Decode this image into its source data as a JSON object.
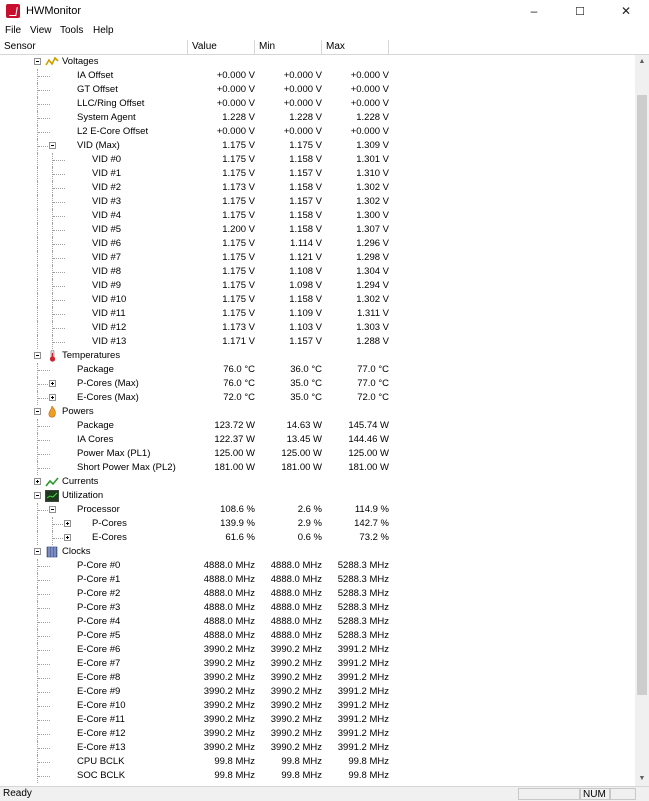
{
  "window": {
    "title": "HWMonitor",
    "minimize": "–",
    "maximize": "☐",
    "close": "✕"
  },
  "menu": [
    "File",
    "View",
    "Tools",
    "Help"
  ],
  "columns": [
    "Sensor",
    "Value",
    "Min",
    "Max"
  ],
  "rows": [
    {
      "depth": 0,
      "type": "category",
      "icon": "voltage-icon",
      "label": "Voltages",
      "exp": "minus"
    },
    {
      "depth": 1,
      "label": "IA Offset",
      "v": "+0.000 V",
      "min": "+0.000 V",
      "max": "+0.000 V"
    },
    {
      "depth": 1,
      "label": "GT Offset",
      "v": "+0.000 V",
      "min": "+0.000 V",
      "max": "+0.000 V"
    },
    {
      "depth": 1,
      "label": "LLC/Ring Offset",
      "v": "+0.000 V",
      "min": "+0.000 V",
      "max": "+0.000 V"
    },
    {
      "depth": 1,
      "label": "System Agent",
      "v": "1.228 V",
      "min": "1.228 V",
      "max": "1.228 V"
    },
    {
      "depth": 1,
      "label": "L2 E-Core Offset",
      "v": "+0.000 V",
      "min": "+0.000 V",
      "max": "+0.000 V"
    },
    {
      "depth": 1,
      "label": "VID (Max)",
      "v": "1.175 V",
      "min": "1.175 V",
      "max": "1.309 V",
      "exp": "minus"
    },
    {
      "depth": 2,
      "label": "VID #0",
      "v": "1.175 V",
      "min": "1.158 V",
      "max": "1.301 V"
    },
    {
      "depth": 2,
      "label": "VID #1",
      "v": "1.175 V",
      "min": "1.157 V",
      "max": "1.310 V"
    },
    {
      "depth": 2,
      "label": "VID #2",
      "v": "1.173 V",
      "min": "1.158 V",
      "max": "1.302 V"
    },
    {
      "depth": 2,
      "label": "VID #3",
      "v": "1.175 V",
      "min": "1.157 V",
      "max": "1.302 V"
    },
    {
      "depth": 2,
      "label": "VID #4",
      "v": "1.175 V",
      "min": "1.158 V",
      "max": "1.300 V"
    },
    {
      "depth": 2,
      "label": "VID #5",
      "v": "1.200 V",
      "min": "1.158 V",
      "max": "1.307 V"
    },
    {
      "depth": 2,
      "label": "VID #6",
      "v": "1.175 V",
      "min": "1.114 V",
      "max": "1.296 V"
    },
    {
      "depth": 2,
      "label": "VID #7",
      "v": "1.175 V",
      "min": "1.121 V",
      "max": "1.298 V"
    },
    {
      "depth": 2,
      "label": "VID #8",
      "v": "1.175 V",
      "min": "1.108 V",
      "max": "1.304 V"
    },
    {
      "depth": 2,
      "label": "VID #9",
      "v": "1.175 V",
      "min": "1.098 V",
      "max": "1.294 V"
    },
    {
      "depth": 2,
      "label": "VID #10",
      "v": "1.175 V",
      "min": "1.158 V",
      "max": "1.302 V"
    },
    {
      "depth": 2,
      "label": "VID #11",
      "v": "1.175 V",
      "min": "1.109 V",
      "max": "1.311 V"
    },
    {
      "depth": 2,
      "label": "VID #12",
      "v": "1.173 V",
      "min": "1.103 V",
      "max": "1.303 V"
    },
    {
      "depth": 2,
      "label": "VID #13",
      "v": "1.171 V",
      "min": "1.157 V",
      "max": "1.288 V"
    },
    {
      "depth": 0,
      "type": "category",
      "icon": "temperature-icon",
      "label": "Temperatures",
      "exp": "minus"
    },
    {
      "depth": 1,
      "label": "Package",
      "v": "76.0 °C",
      "min": "36.0 °C",
      "max": "77.0 °C"
    },
    {
      "depth": 1,
      "label": "P-Cores (Max)",
      "v": "76.0 °C",
      "min": "35.0 °C",
      "max": "77.0 °C",
      "exp": "plus"
    },
    {
      "depth": 1,
      "label": "E-Cores (Max)",
      "v": "72.0 °C",
      "min": "35.0 °C",
      "max": "72.0 °C",
      "exp": "plus"
    },
    {
      "depth": 0,
      "type": "category",
      "icon": "power-icon",
      "label": "Powers",
      "exp": "minus"
    },
    {
      "depth": 1,
      "label": "Package",
      "v": "123.72 W",
      "min": "14.63 W",
      "max": "145.74 W"
    },
    {
      "depth": 1,
      "label": "IA Cores",
      "v": "122.37 W",
      "min": "13.45 W",
      "max": "144.46 W"
    },
    {
      "depth": 1,
      "label": "Power Max (PL1)",
      "v": "125.00 W",
      "min": "125.00 W",
      "max": "125.00 W"
    },
    {
      "depth": 1,
      "label": "Short Power Max (PL2)",
      "v": "181.00 W",
      "min": "181.00 W",
      "max": "181.00 W"
    },
    {
      "depth": 0,
      "type": "category",
      "icon": "current-icon",
      "label": "Currents",
      "exp": "plus"
    },
    {
      "depth": 0,
      "type": "category",
      "icon": "utilization-icon",
      "label": "Utilization",
      "exp": "minus"
    },
    {
      "depth": 1,
      "label": "Processor",
      "v": "108.6 %",
      "min": "2.6 %",
      "max": "114.9 %",
      "exp": "minus"
    },
    {
      "depth": 2,
      "label": "P-Cores",
      "v": "139.9 %",
      "min": "2.9 %",
      "max": "142.7 %",
      "exp": "plus"
    },
    {
      "depth": 2,
      "label": "E-Cores",
      "v": "61.6 %",
      "min": "0.6 %",
      "max": "73.2 %",
      "exp": "plus"
    },
    {
      "depth": 0,
      "type": "category",
      "icon": "clock-icon",
      "label": "Clocks",
      "exp": "minus"
    },
    {
      "depth": 1,
      "label": "P-Core #0",
      "v": "4888.0 MHz",
      "min": "4888.0 MHz",
      "max": "5288.3 MHz"
    },
    {
      "depth": 1,
      "label": "P-Core #1",
      "v": "4888.0 MHz",
      "min": "4888.0 MHz",
      "max": "5288.3 MHz"
    },
    {
      "depth": 1,
      "label": "P-Core #2",
      "v": "4888.0 MHz",
      "min": "4888.0 MHz",
      "max": "5288.3 MHz"
    },
    {
      "depth": 1,
      "label": "P-Core #3",
      "v": "4888.0 MHz",
      "min": "4888.0 MHz",
      "max": "5288.3 MHz"
    },
    {
      "depth": 1,
      "label": "P-Core #4",
      "v": "4888.0 MHz",
      "min": "4888.0 MHz",
      "max": "5288.3 MHz"
    },
    {
      "depth": 1,
      "label": "P-Core #5",
      "v": "4888.0 MHz",
      "min": "4888.0 MHz",
      "max": "5288.3 MHz"
    },
    {
      "depth": 1,
      "label": "E-Core #6",
      "v": "3990.2 MHz",
      "min": "3990.2 MHz",
      "max": "3991.2 MHz"
    },
    {
      "depth": 1,
      "label": "E-Core #7",
      "v": "3990.2 MHz",
      "min": "3990.2 MHz",
      "max": "3991.2 MHz"
    },
    {
      "depth": 1,
      "label": "E-Core #8",
      "v": "3990.2 MHz",
      "min": "3990.2 MHz",
      "max": "3991.2 MHz"
    },
    {
      "depth": 1,
      "label": "E-Core #9",
      "v": "3990.2 MHz",
      "min": "3990.2 MHz",
      "max": "3991.2 MHz"
    },
    {
      "depth": 1,
      "label": "E-Core #10",
      "v": "3990.2 MHz",
      "min": "3990.2 MHz",
      "max": "3991.2 MHz"
    },
    {
      "depth": 1,
      "label": "E-Core #11",
      "v": "3990.2 MHz",
      "min": "3990.2 MHz",
      "max": "3991.2 MHz"
    },
    {
      "depth": 1,
      "label": "E-Core #12",
      "v": "3990.2 MHz",
      "min": "3990.2 MHz",
      "max": "3991.2 MHz"
    },
    {
      "depth": 1,
      "label": "E-Core #13",
      "v": "3990.2 MHz",
      "min": "3990.2 MHz",
      "max": "3991.2 MHz"
    },
    {
      "depth": 1,
      "label": "CPU BCLK",
      "v": "99.8 MHz",
      "min": "99.8 MHz",
      "max": "99.8 MHz"
    },
    {
      "depth": 1,
      "label": "SOC BCLK",
      "v": "99.8 MHz",
      "min": "99.8 MHz",
      "max": "99.8 MHz"
    }
  ],
  "status": {
    "text": "Ready",
    "num": "NUM"
  },
  "colors": {
    "app_icon": "#c8102e",
    "header_border": "#d6d6d6",
    "scroll_thumb": "#cdcdcd"
  }
}
